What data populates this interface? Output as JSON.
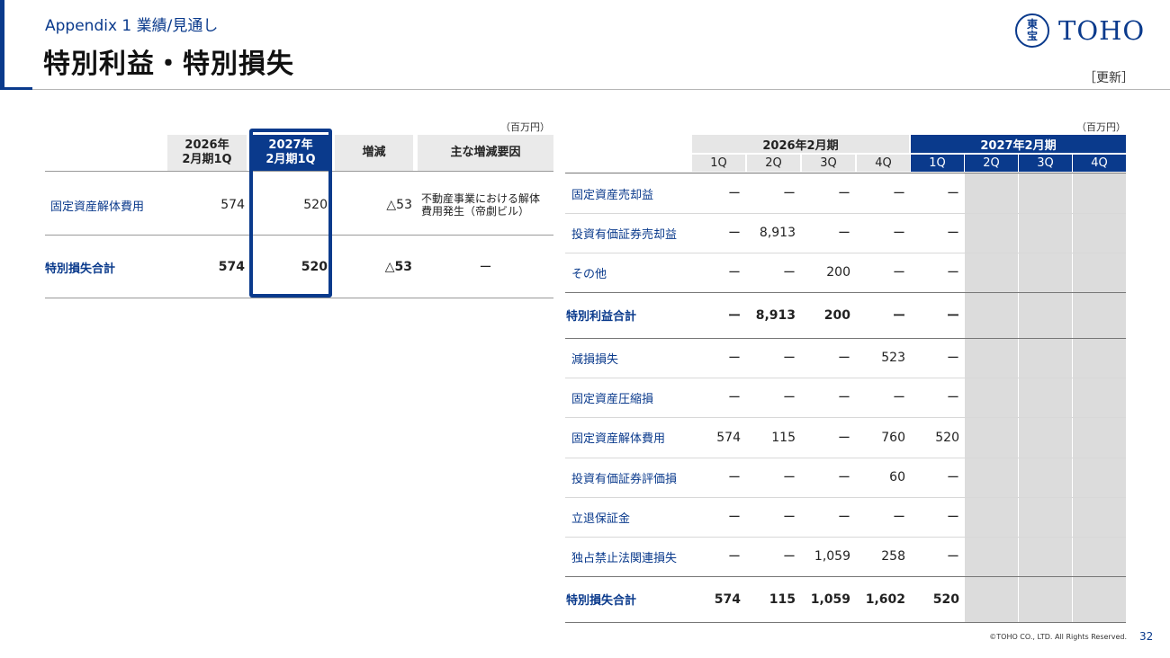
{
  "header": {
    "subtitle": "Appendix 1 業績/見通し",
    "title": "特別利益・特別損失",
    "logo_seal_top": "東",
    "logo_seal_bottom": "宝",
    "logo_text": "TOHO",
    "update_tag": "［更新］"
  },
  "left_table": {
    "unit": "（百万円）",
    "headers": [
      "2026年\n2月期1Q",
      "2027年\n2月期1Q",
      "増減",
      "主な増減要因"
    ],
    "header_col1_line1": "2026年",
    "header_col1_line2": "2月期1Q",
    "header_col2_line1": "2027年",
    "header_col2_line2": "2月期1Q",
    "header_col3": "増減",
    "header_col4": "主な増減要因",
    "rows": [
      {
        "label": "固定資産解体費用",
        "v2026": "574",
        "v2027": "520",
        "change": "△53",
        "reason_line1": "不動産事業における解体",
        "reason_line2": "費用発生（帝劇ビル）"
      },
      {
        "label": "特別損失合計",
        "v2026": "574",
        "v2027": "520",
        "change": "△53",
        "reason": "ー"
      }
    ]
  },
  "right_table": {
    "unit": "（百万円）",
    "period_2026": "2026年2月期",
    "period_2027": "2027年2月期",
    "quarters": [
      "1Q",
      "2Q",
      "3Q",
      "4Q",
      "1Q",
      "2Q",
      "3Q",
      "4Q"
    ],
    "rows": [
      {
        "label": "固定資産売却益",
        "values": [
          "ー",
          "ー",
          "ー",
          "ー",
          "ー"
        ],
        "total": false
      },
      {
        "label": "投資有価証券売却益",
        "values": [
          "ー",
          "8,913",
          "ー",
          "ー",
          "ー"
        ],
        "total": false
      },
      {
        "label": "その他",
        "values": [
          "ー",
          "ー",
          "200",
          "ー",
          "ー"
        ],
        "total": false
      },
      {
        "label": "特別利益合計",
        "values": [
          "ー",
          "8,913",
          "200",
          "ー",
          "ー"
        ],
        "total": true
      },
      {
        "label": "減損損失",
        "values": [
          "ー",
          "ー",
          "ー",
          "523",
          "ー"
        ],
        "total": false
      },
      {
        "label": "固定資産圧縮損",
        "values": [
          "ー",
          "ー",
          "ー",
          "ー",
          "ー"
        ],
        "total": false
      },
      {
        "label": "固定資産解体費用",
        "values": [
          "574",
          "115",
          "ー",
          "760",
          "520"
        ],
        "total": false
      },
      {
        "label": "投資有価証券評価損",
        "values": [
          "ー",
          "ー",
          "ー",
          "60",
          "ー"
        ],
        "total": false
      },
      {
        "label": "立退保証金",
        "values": [
          "ー",
          "ー",
          "ー",
          "ー",
          "ー"
        ],
        "total": false
      },
      {
        "label": "独占禁止法関連損失",
        "values": [
          "ー",
          "ー",
          "1,059",
          "258",
          "ー"
        ],
        "total": false
      },
      {
        "label": "特別損失合計",
        "values": [
          "574",
          "115",
          "1,059",
          "1,602",
          "520"
        ],
        "total": true
      }
    ]
  },
  "footer": {
    "copyright": "©TOHO CO., LTD. All Rights Reserved.",
    "page_number": "32"
  },
  "colors": {
    "brand_blue": "#0a3a8c",
    "header_gray": "#eaeaea",
    "future_shade": "#dcdcdc"
  }
}
